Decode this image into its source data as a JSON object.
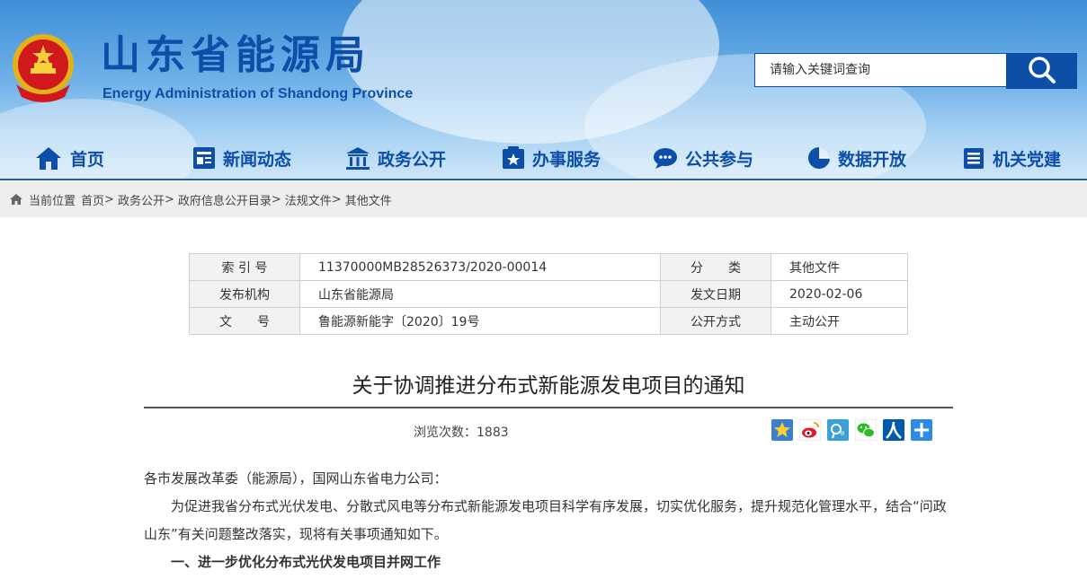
{
  "site": {
    "title": "山东省能源局",
    "subtitle": "Energy Administration of Shandong Province"
  },
  "search": {
    "placeholder": "请输入关键词查询"
  },
  "nav": [
    {
      "label": "首页",
      "icon": "home-icon"
    },
    {
      "label": "新闻动态",
      "icon": "news-icon"
    },
    {
      "label": "政务公开",
      "icon": "government-icon"
    },
    {
      "label": "办事服务",
      "icon": "service-icon"
    },
    {
      "label": "公共参与",
      "icon": "chat-icon"
    },
    {
      "label": "数据开放",
      "icon": "pie-chart-icon"
    },
    {
      "label": "机关党建",
      "icon": "party-building-icon"
    }
  ],
  "breadcrumb": {
    "prefix": "当前位置",
    "items": [
      "首页",
      "政务公开",
      "政府信息公开目录",
      "法规文件",
      "其他文件"
    ],
    "separator": ">"
  },
  "meta": {
    "rows": [
      {
        "l1": "索 引 号",
        "v1": "11370000MB28526373/2020-00014",
        "l2": "分　　类",
        "v2": "其他文件"
      },
      {
        "l1": "发布机构",
        "v1": "山东省能源局",
        "l2": "发文日期",
        "v2": "2020-02-06"
      },
      {
        "l1": "文　　号",
        "v1": "鲁能源新能字〔2020〕19号",
        "l2": "公开方式",
        "v2": "主动公开"
      }
    ]
  },
  "article": {
    "title": "关于协调推进分布式新能源发电项目的通知",
    "views_label": "浏览次数：",
    "views_count": "1883",
    "recipient": "各市发展改革委（能源局），国网山东省电力公司：",
    "paragraph1": "为促进我省分布式光伏发电、分散式风电等分布式新能源发电项目科学有序发展，切实优化服务，提升规范化管理水平，结合“问政山东”有关问题整改落实，现将有关事项通知如下。",
    "section1": "一、进一步优化分布式光伏发电项目并网工作"
  },
  "share_icons": [
    "favorite-icon",
    "weibo-icon",
    "tencent-weibo-icon",
    "wechat-icon",
    "renren-icon",
    "more-share-icon"
  ],
  "colors": {
    "brand_blue": "#0d4ea8",
    "crumb_bg": "#eeeeee"
  }
}
